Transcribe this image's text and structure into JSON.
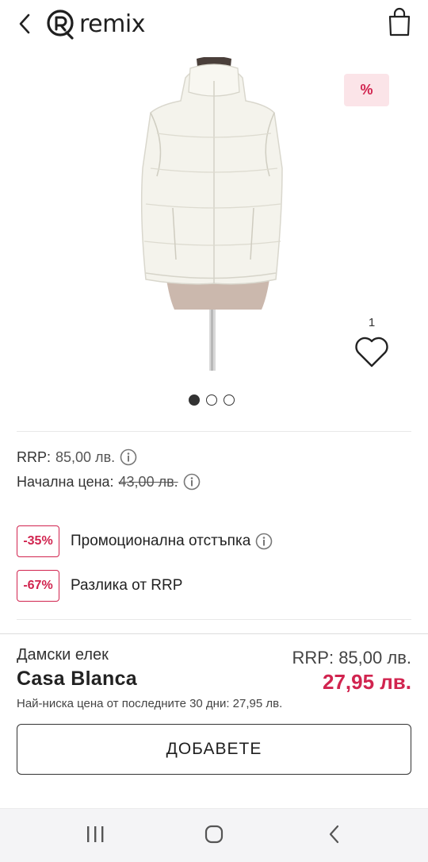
{
  "header": {
    "logo_text": "remix"
  },
  "product": {
    "discount_tag": "%",
    "favorites_count": "1",
    "image_dots": 3,
    "active_dot": 0
  },
  "prices": {
    "rrp_label": "RRP:",
    "rrp_value": "85,00 лв.",
    "initial_label": "Начална цена:",
    "initial_value": "43,00 лв."
  },
  "promos": [
    {
      "badge": "-35%",
      "label": "Промоционална отстъпка"
    },
    {
      "badge": "-67%",
      "label": "Разлика от RRP"
    }
  ],
  "summary": {
    "product_type": "Дамски елек",
    "brand": "Casa Blanca",
    "rrp_text": "RRP: 85,00 лв.",
    "final_price": "27,95 лв.",
    "lowest_price_note": "Най-ниска цена от последните 30 дни: 27,95 лв.",
    "add_button": "ДОБАВЕТЕ"
  },
  "colors": {
    "accent": "#d1244f",
    "accent_bg": "#fbe4e8"
  }
}
